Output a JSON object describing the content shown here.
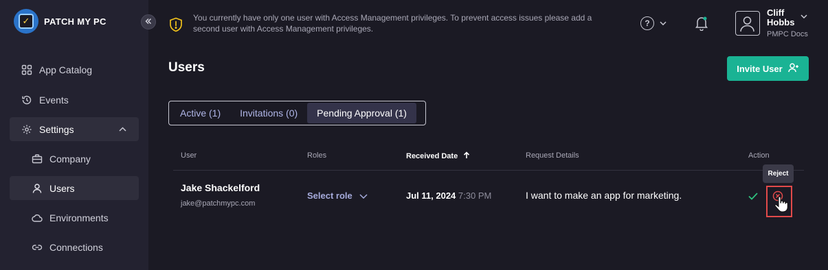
{
  "brand": {
    "name": "PATCH MY PC"
  },
  "sidebar": {
    "items": [
      {
        "label": "App Catalog",
        "icon": "grid-icon"
      },
      {
        "label": "Events",
        "icon": "history-icon"
      },
      {
        "label": "Settings",
        "icon": "gear-icon"
      },
      {
        "label": "Company",
        "icon": "briefcase-icon"
      },
      {
        "label": "Users",
        "icon": "user-icon"
      },
      {
        "label": "Environments",
        "icon": "cloud-icon"
      },
      {
        "label": "Connections",
        "icon": "link-icon"
      }
    ]
  },
  "header": {
    "banner": "You currently have only one user with Access Management privileges. To prevent access issues please add a second user with Access Management privileges.",
    "user": {
      "name": "Cliff Hobbs",
      "org": "PMPC Docs"
    }
  },
  "page": {
    "title": "Users",
    "invite_label": "Invite User",
    "tabs": [
      {
        "label": "Active (1)"
      },
      {
        "label": "Invitations (0)"
      },
      {
        "label": "Pending Approval (1)"
      }
    ]
  },
  "table": {
    "headers": {
      "user": "User",
      "roles": "Roles",
      "received_date": "Received Date",
      "request_details": "Request Details",
      "action": "Action"
    },
    "rows": [
      {
        "name": "Jake Shackelford",
        "email": "jake@patchmypc.com",
        "role": "Select role",
        "date": "Jul 11, 2024",
        "time": "7:30 PM",
        "details": "I want to make an app for marketing."
      }
    ]
  },
  "tooltip": {
    "text": "Reject"
  },
  "colors": {
    "accent": "#1ab394",
    "reject": "#e24a4a",
    "approve": "#2ec27e"
  }
}
